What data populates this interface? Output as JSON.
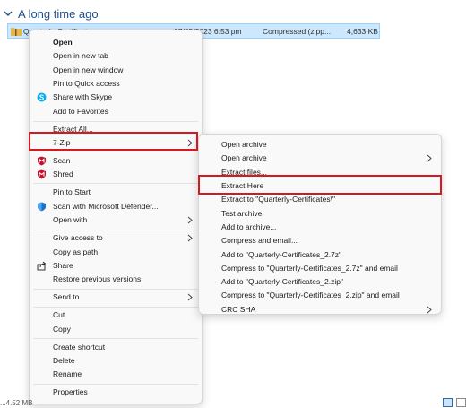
{
  "group": {
    "header": "A long time ago"
  },
  "file": {
    "name": "Quarterly-Certificates",
    "date": "07/05/2023 6:53 pm",
    "type": "Compressed (zipp...",
    "size": "4,633 KB"
  },
  "context_menu": {
    "open": "Open",
    "open_new_tab": "Open in new tab",
    "open_new_window": "Open in new window",
    "pin_quick_access": "Pin to Quick access",
    "share_skype": "Share with Skype",
    "add_favorites": "Add to Favorites",
    "extract_all": "Extract All...",
    "seven_zip": "7-Zip",
    "scan": "Scan",
    "shred": "Shred",
    "pin_start": "Pin to Start",
    "scan_defender": "Scan with Microsoft Defender...",
    "open_with": "Open with",
    "give_access": "Give access to",
    "copy_path": "Copy as path",
    "share": "Share",
    "restore_versions": "Restore previous versions",
    "send_to": "Send to",
    "cut": "Cut",
    "copy": "Copy",
    "create_shortcut": "Create shortcut",
    "delete": "Delete",
    "rename": "Rename",
    "properties": "Properties"
  },
  "submenu": {
    "open_archive": "Open archive",
    "open_archive_2": "Open archive",
    "extract_files": "Extract files...",
    "extract_here": "Extract Here",
    "extract_to": "Extract to \"Quarterly-Certificates\\\"",
    "test_archive": "Test archive",
    "add_archive": "Add to archive...",
    "compress_email": "Compress and email...",
    "add_7z": "Add to \"Quarterly-Certificates_2.7z\"",
    "compress_7z_email": "Compress to \"Quarterly-Certificates_2.7z\" and email",
    "add_zip": "Add to \"Quarterly-Certificates_2.zip\"",
    "compress_zip_email": "Compress to \"Quarterly-Certificates_2.zip\" and email",
    "crc_sha": "CRC SHA"
  },
  "status": {
    "left": "...4.52 MB"
  },
  "colors": {
    "highlight_box": "#d7191f",
    "selection": "#cce8ff",
    "mcafee_red": "#c8102e",
    "skype_blue": "#00aff0"
  }
}
